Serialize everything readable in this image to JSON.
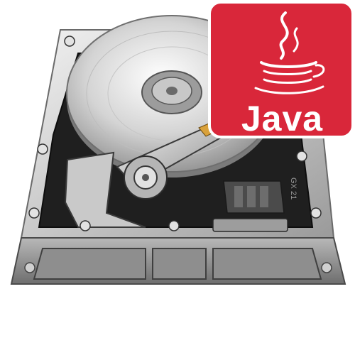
{
  "logo": {
    "text": "Java",
    "icon": "java-coffee-cup-icon",
    "background_color": "#d9273a",
    "text_color": "#ffffff"
  },
  "drive": {
    "icon": "hard-disk-drive-icon",
    "label_text": "GX 21"
  },
  "colors": {
    "chassis_light": "#e6e6e6",
    "chassis_dark": "#5b5b5b",
    "interior": "#222222",
    "platter": "#d8d8d8"
  }
}
